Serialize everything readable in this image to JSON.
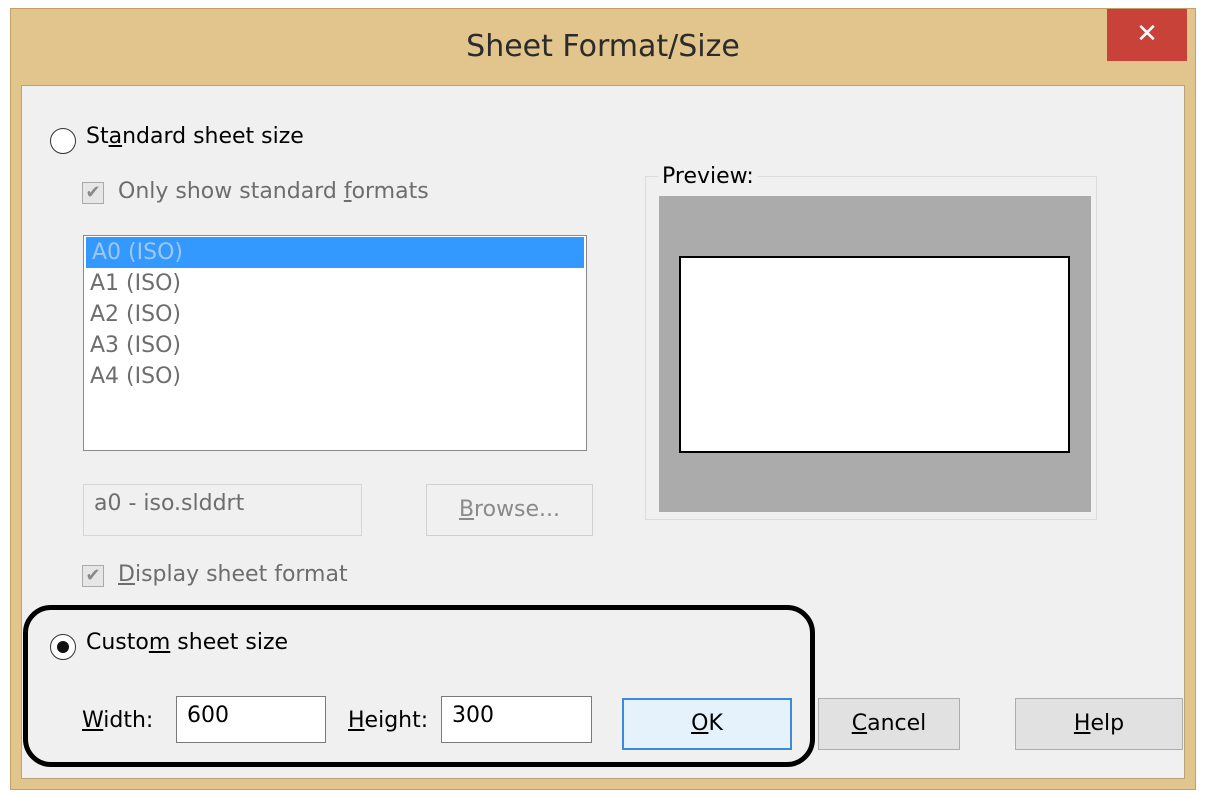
{
  "window": {
    "title": "Sheet Format/Size",
    "close_glyph": "✕"
  },
  "standard": {
    "radio_label_pre": "St",
    "radio_label_u": "a",
    "radio_label_post": "ndard sheet size",
    "selected": false,
    "only_standard_pre": "Only show standard ",
    "only_standard_u": "f",
    "only_standard_post": "ormats",
    "only_standard_checked": true,
    "formats": [
      "A0 (ISO)",
      "A1 (ISO)",
      "A2 (ISO)",
      "A3 (ISO)",
      "A4 (ISO)"
    ],
    "selected_format": "A0 (ISO)",
    "format_file": "a0 - iso.slddrt",
    "browse_u": "B",
    "browse_post": "rowse...",
    "display_u": "D",
    "display_post": "isplay sheet format",
    "display_checked": true
  },
  "preview": {
    "label": "Preview:"
  },
  "custom": {
    "radio_label_pre": "Custo",
    "radio_label_u": "m",
    "radio_label_post": " sheet size",
    "selected": true,
    "width_u": "W",
    "width_post": "idth:",
    "width_value": "600",
    "height_u": "H",
    "height_post": "eight:",
    "height_value": "300"
  },
  "buttons": {
    "ok_u": "O",
    "ok_post": "K",
    "cancel_u": "C",
    "cancel_post": "ancel",
    "help_u": "H",
    "help_post": "elp"
  },
  "colors": {
    "frame": "#e2c48d",
    "close": "#c9423a",
    "selection": "#3399ff",
    "highlight": "#000000"
  },
  "icons": {
    "check": "✔"
  }
}
